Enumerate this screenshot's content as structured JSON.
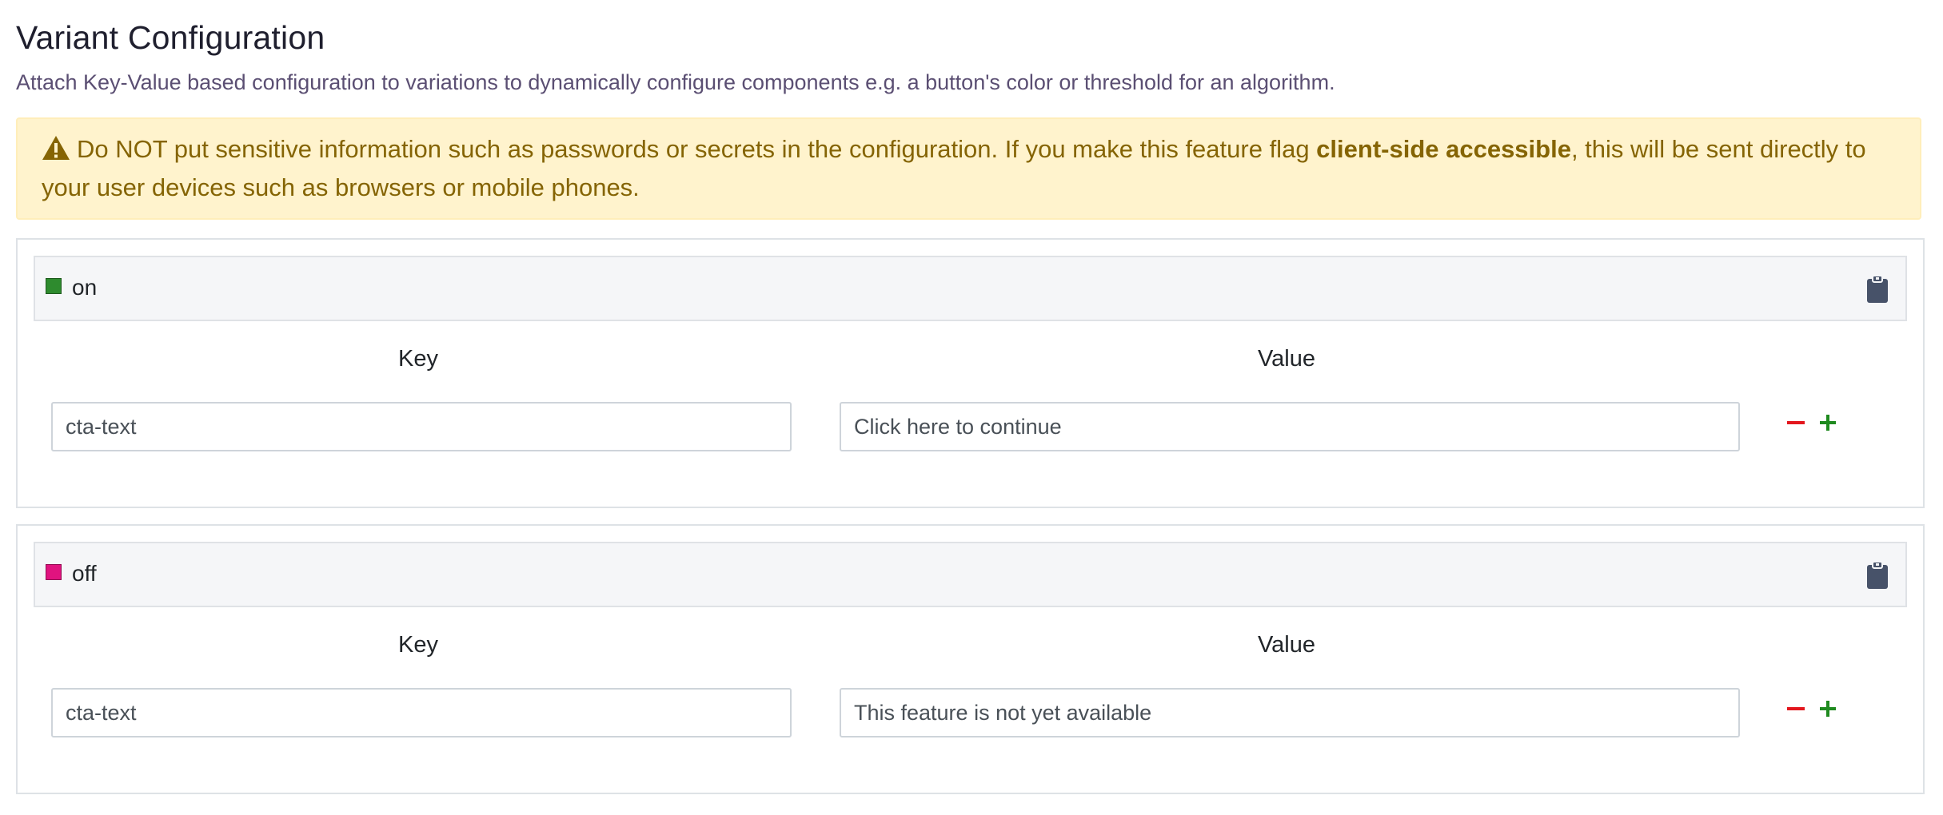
{
  "header": {
    "title": "Variant Configuration",
    "subtitle": "Attach Key-Value based configuration to variations to dynamically configure components e.g. a button's color or threshold for an algorithm."
  },
  "alert": {
    "icon": "warning-icon",
    "text_before": "Do NOT put sensitive information such as passwords or secrets in the configuration. If you make this feature flag ",
    "text_bold": "client-side accessible",
    "text_after": ", this will be sent directly to your user devices such as browsers or mobile phones."
  },
  "colors": {
    "on_swatch": "#2e8b2e",
    "off_swatch": "#e0137f",
    "remove": "#e3161d",
    "add": "#1f8a1f",
    "clipboard": "#475269"
  },
  "variants": [
    {
      "name": "on",
      "key_label": "Key",
      "value_label": "Value",
      "rows": [
        {
          "key": "cta-text",
          "value": "Click here to continue"
        }
      ]
    },
    {
      "name": "off",
      "key_label": "Key",
      "value_label": "Value",
      "rows": [
        {
          "key": "cta-text",
          "value": "This feature is not yet available"
        }
      ]
    }
  ]
}
